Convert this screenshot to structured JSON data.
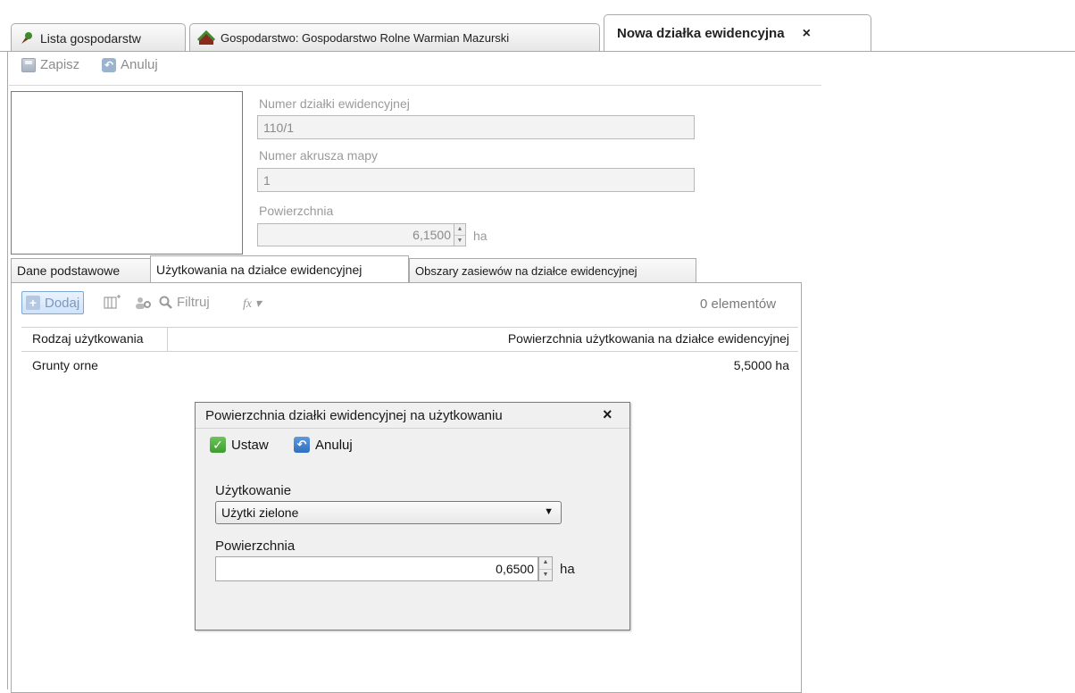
{
  "doc_tabs": [
    {
      "label": "Lista gospodarstw",
      "icon": "farm-tree-icon"
    },
    {
      "label": "Gospodarstwo: Gospodarstwo Rolne Warmian Mazurski",
      "icon": "farm-house-icon"
    },
    {
      "label": "Nowa działka ewidencyjna",
      "close": "×"
    }
  ],
  "toolbar": {
    "save_label": "Zapisz",
    "cancel_label": "Anuluj"
  },
  "form": {
    "plot_number_label": "Numer działki ewidencyjnej",
    "plot_number_value": "110/1",
    "map_sheet_label": "Numer akrusza mapy",
    "map_sheet_value": "1",
    "area_label": "Powierzchnia",
    "area_value": "6,1500",
    "area_unit": "ha"
  },
  "inner_tabs": [
    {
      "label": "Dane podstawowe"
    },
    {
      "label": "Użytkowania na działce ewidencyjnej"
    },
    {
      "label": "Obszary zasiewów na działce ewidencyjnej"
    }
  ],
  "grid_toolbar": {
    "add_label": "Dodaj",
    "filter_label": "Filtruj",
    "fx_label": "fx ▾",
    "count": "0 elementów"
  },
  "grid": {
    "columns": [
      "Rodzaj użytkowania",
      "Powierzchnia użytkowania na działce ewidencyjnej"
    ],
    "rows": [
      {
        "type": "Grunty orne",
        "area": "5,5000 ha"
      }
    ]
  },
  "dialog": {
    "title": "Powierzchnia działki ewidencyjnej na użytkowaniu",
    "close": "×",
    "set_label": "Ustaw",
    "cancel_label": "Anuluj",
    "use_label": "Użytkowanie",
    "use_value": "Użytki zielone",
    "area_label": "Powierzchnia",
    "area_value": "0,6500",
    "area_unit": "ha"
  }
}
